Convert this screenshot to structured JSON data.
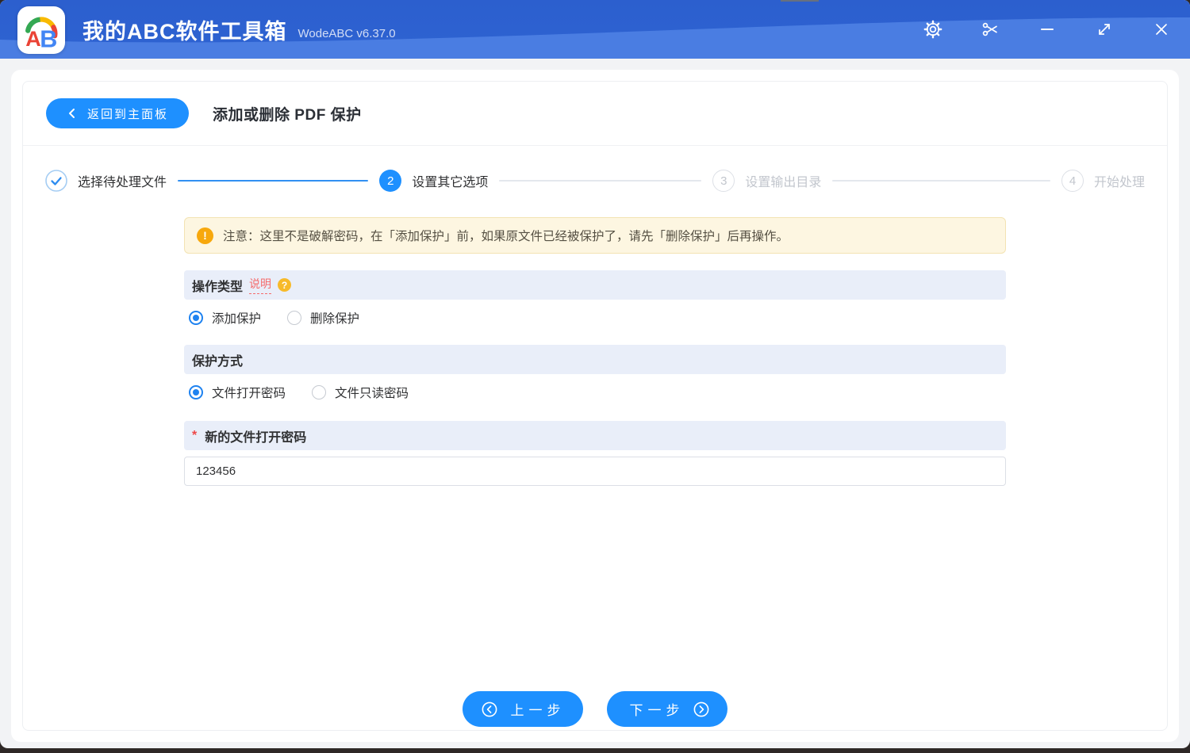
{
  "titlebar": {
    "app_title": "我的ABC软件工具箱",
    "version": "WodeABC v6.37.0",
    "logo_letters": "AB",
    "control_icons": [
      "settings-icon",
      "scissors-icon",
      "minimize-icon",
      "maximize-icon",
      "close-icon"
    ]
  },
  "header": {
    "back_label": "返回到主面板",
    "page_title": "添加或删除 PDF 保护"
  },
  "steps": [
    {
      "num": "1",
      "state": "done",
      "label": "选择待处理文件"
    },
    {
      "num": "2",
      "state": "active",
      "label": "设置其它选项"
    },
    {
      "num": "3",
      "state": "pending",
      "label": "设置输出目录"
    },
    {
      "num": "4",
      "state": "pending",
      "label": "开始处理"
    }
  ],
  "notice": {
    "icon": "warning-icon",
    "icon_glyph": "!",
    "text": "注意：这里不是破解密码，在「添加保护」前，如果原文件已经被保护了，请先「删除保护」后再操作。"
  },
  "sections": {
    "operation_type": {
      "title": "操作类型",
      "help_link": "说明",
      "help_icon_glyph": "?",
      "options": [
        {
          "label": "添加保护",
          "selected": true
        },
        {
          "label": "删除保护",
          "selected": false
        }
      ]
    },
    "protection_method": {
      "title": "保护方式",
      "options": [
        {
          "label": "文件打开密码",
          "selected": true
        },
        {
          "label": "文件只读密码",
          "selected": false
        }
      ]
    },
    "password": {
      "required_marker": "*",
      "title": "新的文件打开密码",
      "value": "123456"
    }
  },
  "footer": {
    "prev_label": "上一步",
    "next_label": "下一步"
  },
  "colors": {
    "accent": "#1e90ff",
    "titlebar_top": "#2c5fce",
    "titlebar_wave": "#4a7de2",
    "app_background": "#f2f3f5",
    "section_header_bg": "#e9eef9",
    "notice_bg": "#fdf6e1",
    "notice_border": "#f3e3b3",
    "warning_icon": "#f7a80d",
    "help_icon": "#f7ba2a",
    "help_link": "#f56c6c",
    "radio_checked": "#1e82f0",
    "step_pending_text": "#c2c6cd",
    "text_primary": "#303133"
  }
}
